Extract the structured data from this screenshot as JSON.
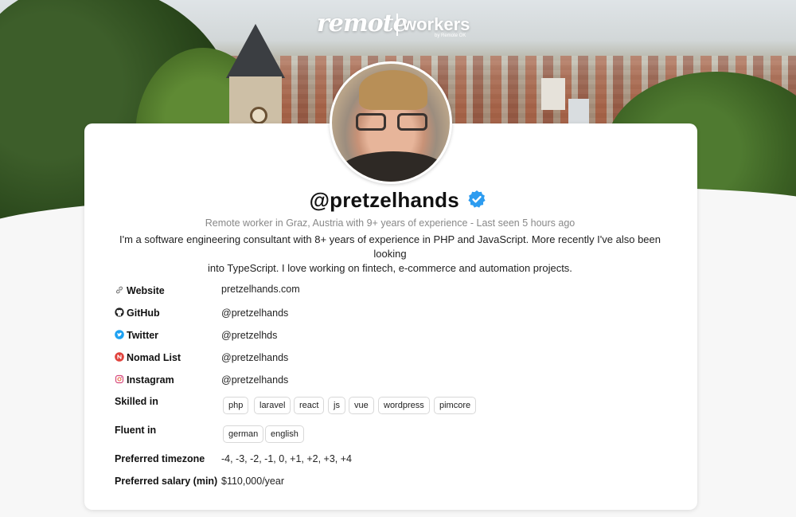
{
  "header": {
    "logo_left": "remote",
    "logo_right": "workers",
    "logo_byline": "by Remote OK"
  },
  "profile": {
    "handle": "@pretzelhands",
    "verified": true,
    "subline": "Remote worker in Graz, Austria with 9+ years of experience - Last seen 5 hours ago",
    "bio_line1": "I'm a software engineering consultant with 8+ years of experience in PHP and JavaScript. More recently I've also been looking",
    "bio_line2": "into TypeScript. I love working on fintech, e-commerce and automation projects."
  },
  "details": {
    "website": {
      "label": "Website",
      "value": "pretzelhands.com",
      "icon": "link-icon"
    },
    "github": {
      "label": "GitHub",
      "value": "@pretzelhands",
      "icon": "github-icon"
    },
    "twitter": {
      "label": "Twitter",
      "value": "@pretzelhds",
      "icon": "twitter-icon"
    },
    "nomadlist": {
      "label": "Nomad List",
      "value": "@pretzelhands",
      "icon": "nomadlist-icon"
    },
    "instagram": {
      "label": "Instagram",
      "value": "@pretzelhands",
      "icon": "instagram-icon"
    },
    "skills": {
      "label": "Skilled in",
      "items": [
        "php",
        "laravel",
        "react",
        "js",
        "vue",
        "wordpress",
        "pimcore"
      ]
    },
    "languages": {
      "label": "Fluent in",
      "items": [
        "german",
        "english"
      ]
    },
    "timezone": {
      "label": "Preferred timezone",
      "value": "-4, -3, -2, -1, 0, +1, +2, +3, +4"
    },
    "salary": {
      "label": "Preferred salary (min)",
      "value": "$110,000/year"
    }
  },
  "colors": {
    "verified_blue": "#2d9cf0",
    "twitter_blue": "#1da1f2",
    "nomadlist_red": "#e0413b",
    "card_bg": "#ffffff",
    "page_bg": "#f7f7f7"
  }
}
